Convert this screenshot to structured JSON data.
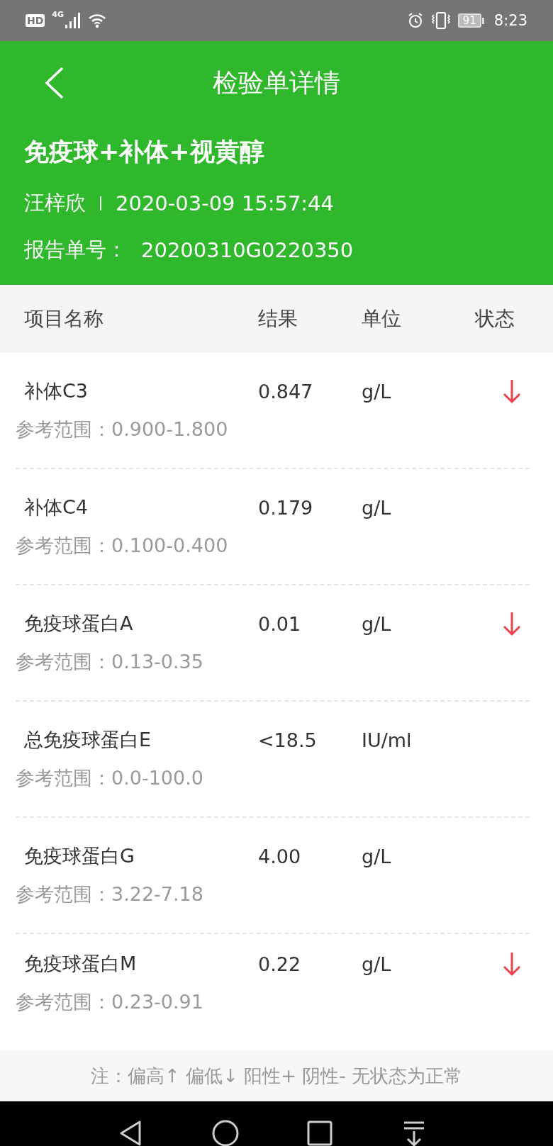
{
  "status_bar": {
    "hd": "HD",
    "network": "4G",
    "battery": "91",
    "time": "8:23"
  },
  "app_bar": {
    "title": "检验单详情"
  },
  "report": {
    "test_name": "免疫球+补体+视黄醇",
    "patient": "汪梓欣",
    "datetime": "2020-03-09 15:57:44",
    "number_label": "报告单号：",
    "number": "20200310G0220350"
  },
  "table": {
    "columns": [
      "项目名称",
      "结果",
      "单位",
      "状态"
    ],
    "rows": [
      {
        "name": "补体C3",
        "result": "0.847",
        "unit": "g/L",
        "reference": "参考范围：0.900-1.800",
        "low": true
      },
      {
        "name": "补体C4",
        "result": "0.179",
        "unit": "g/L",
        "reference": "参考范围：0.100-0.400",
        "low": false
      },
      {
        "name": "免疫球蛋白A",
        "result": "0.01",
        "unit": "g/L",
        "reference": "参考范围：0.13-0.35",
        "low": true
      },
      {
        "name": "总免疫球蛋白E",
        "result": "<18.5",
        "unit": "IU/ml",
        "reference": "参考范围：0.0-100.0",
        "low": false
      },
      {
        "name": "免疫球蛋白G",
        "result": "4.00",
        "unit": "g/L",
        "reference": "参考范围：3.22-7.18",
        "low": false
      },
      {
        "name": "免疫球蛋白M",
        "result": "0.22",
        "unit": "g/L",
        "reference": "参考范围：0.23-0.91",
        "low": true
      }
    ]
  },
  "footer_note": "注：偏高↑ 偏低↓ 阳性+ 阴性- 无状态为正常"
}
